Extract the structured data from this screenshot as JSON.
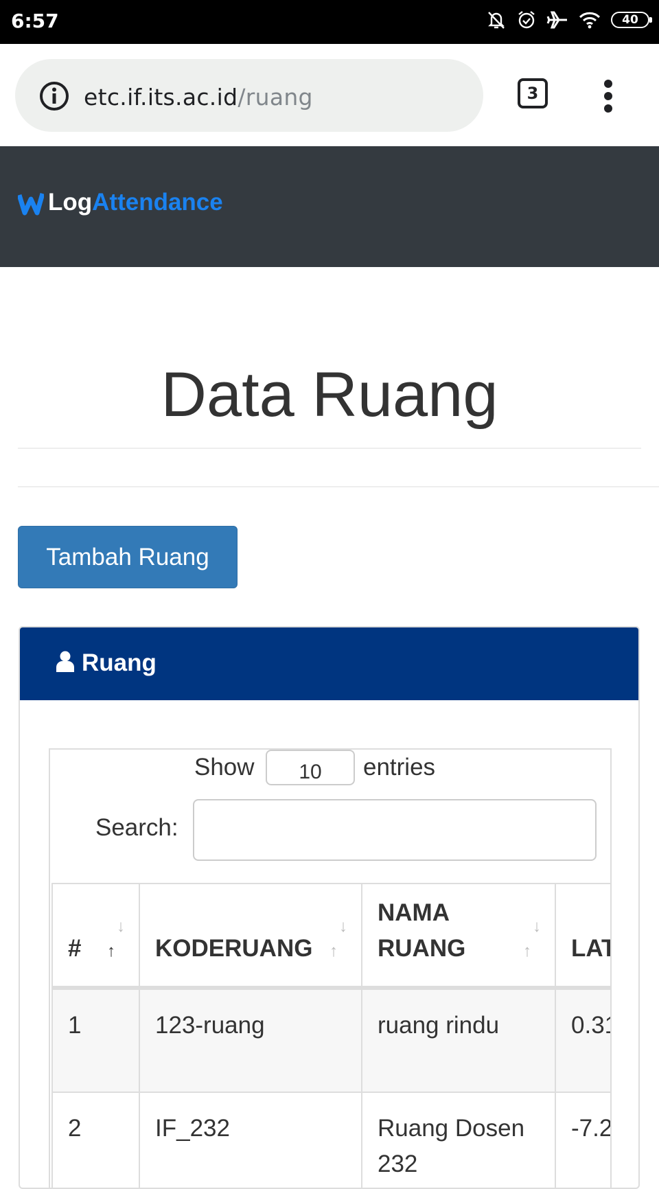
{
  "status_bar": {
    "time": "6:57",
    "battery": "40",
    "icons": [
      "bell-off-icon",
      "alarm-icon",
      "airplane-icon",
      "wifi-icon",
      "battery-icon"
    ]
  },
  "browser": {
    "url_host": "etc.if.its.ac.id",
    "url_path": "/ruang",
    "tab_count": "3"
  },
  "navbar": {
    "brand_part1": "Log",
    "brand_part2": "Attendance",
    "brand_color": "#1a82f0",
    "background": "#343a40"
  },
  "page": {
    "title": "Data Ruang",
    "add_button": "Tambah Ruang"
  },
  "panel": {
    "title": "Ruang",
    "heading_color": "#003580"
  },
  "datatable": {
    "show_label": "Show",
    "entries_value": "10",
    "entries_label": "entries",
    "search_label": "Search:",
    "search_value": "",
    "columns": [
      "#",
      "KODERUANG",
      "NAMA RUANG",
      "LAT"
    ],
    "rows": [
      [
        "1",
        "123-ruang",
        "ruang rindu",
        "0.31"
      ],
      [
        "2",
        "IF_232",
        "Ruang Dosen 232",
        "-7.2"
      ]
    ]
  }
}
